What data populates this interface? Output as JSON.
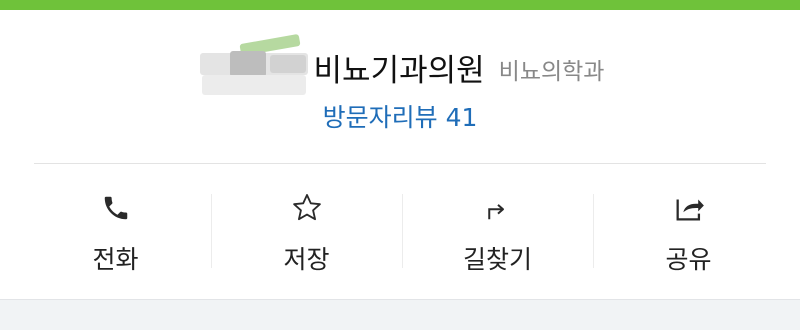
{
  "header": {
    "place_name": "비뇨기과의원",
    "category": "비뇨의학과"
  },
  "reviews": {
    "label": "방문자리뷰",
    "count": "41"
  },
  "actions": [
    {
      "label": "전화",
      "icon": "phone-icon"
    },
    {
      "label": "저장",
      "icon": "star-icon"
    },
    {
      "label": "길찾기",
      "icon": "directions-icon"
    },
    {
      "label": "공유",
      "icon": "share-icon"
    }
  ],
  "colors": {
    "top_strip": "#6fc23a",
    "review_link": "#1f6db8",
    "category": "#888888",
    "text": "#222222"
  }
}
